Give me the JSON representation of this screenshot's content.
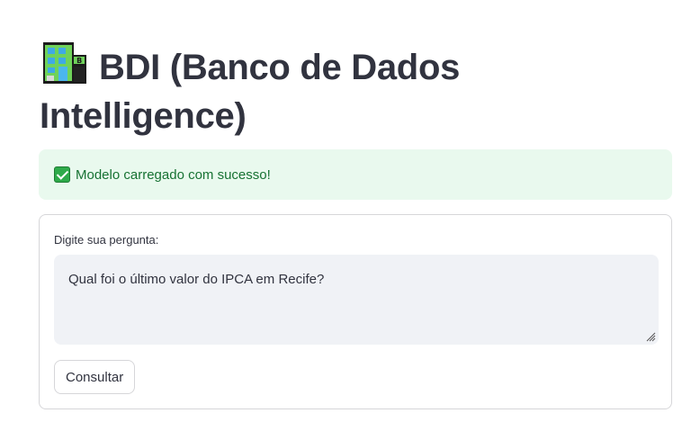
{
  "header": {
    "title_icon": "office-building-icon",
    "title": "BDI (Banco de Dados Intelligence)"
  },
  "alert": {
    "icon": "check-mark-button-icon",
    "message": "Modelo carregado com sucesso!",
    "colors": {
      "background": "#e9f9ee",
      "text": "#177233"
    }
  },
  "form": {
    "question_label": "Digite sua pergunta:",
    "question_value": "Qual foi o último valor do IPCA em Recife?",
    "submit_label": "Consultar"
  }
}
